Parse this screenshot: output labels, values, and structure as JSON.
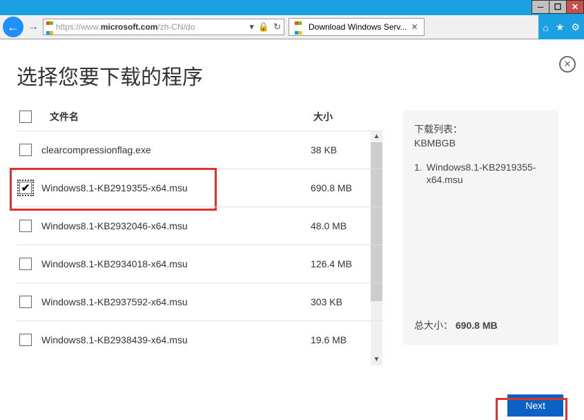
{
  "titlebar": {
    "min": "─",
    "max": "☐",
    "close": "✕"
  },
  "chrome": {
    "url_prefix": "https://www.",
    "url_domain": "microsoft.com",
    "url_suffix": "/zh-CN/do",
    "lock": "🔒",
    "refresh": "↻",
    "tab_title": "Download Windows Serv...",
    "tab_close": "✕",
    "home": "⌂",
    "star": "★",
    "gear": "⚙"
  },
  "page": {
    "close": "✕",
    "heading": "选择您要下载的程序",
    "col_name": "文件名",
    "col_size": "大小"
  },
  "files": [
    {
      "name": "clearcompressionflag.exe",
      "size": "38 KB",
      "checked": false,
      "highlight": false
    },
    {
      "name": "Windows8.1-KB2919355-x64.msu",
      "size": "690.8 MB",
      "checked": true,
      "highlight": true
    },
    {
      "name": "Windows8.1-KB2932046-x64.msu",
      "size": "48.0 MB",
      "checked": false,
      "highlight": false
    },
    {
      "name": "Windows8.1-KB2934018-x64.msu",
      "size": "126.4 MB",
      "checked": false,
      "highlight": false
    },
    {
      "name": "Windows8.1-KB2937592-x64.msu",
      "size": "303 KB",
      "checked": false,
      "highlight": false
    },
    {
      "name": "Windows8.1-KB2938439-x64.msu",
      "size": "19.6 MB",
      "checked": false,
      "highlight": false
    }
  ],
  "side": {
    "title": "下载列表：",
    "sub": "KBMBGB",
    "items": [
      {
        "n": "1.",
        "t": "Windows8.1-KB2919355-x64.msu"
      }
    ],
    "total_label": "总大小：",
    "total_value": "690.8 MB"
  },
  "next": "Next",
  "scroll": {
    "up": "▲",
    "down": "▼"
  }
}
